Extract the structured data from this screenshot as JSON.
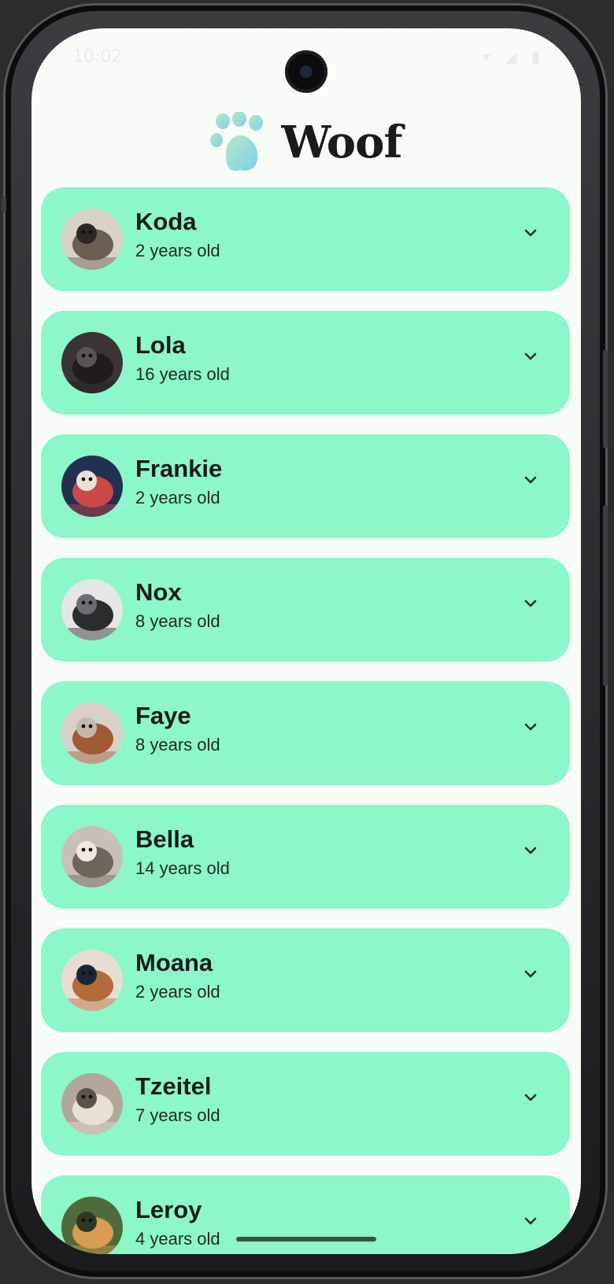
{
  "app": {
    "title": "Woof"
  },
  "status_bar": {
    "time": "10:02",
    "icons": "▾ ◢ ▮"
  },
  "dogs": [
    {
      "name": "Koda",
      "age": "2 years old",
      "photo": "husky-dog-photo",
      "palette": [
        "#d9d2c6",
        "#6b5e52",
        "#2d2826"
      ]
    },
    {
      "name": "Lola",
      "age": "16 years old",
      "photo": "black-dog-photo",
      "palette": [
        "#3a3532",
        "#1f1c1b",
        "#5a534e"
      ]
    },
    {
      "name": "Frankie",
      "age": "2 years old",
      "photo": "small-dog-photo",
      "palette": [
        "#223052",
        "#c94848",
        "#e9e2d8"
      ]
    },
    {
      "name": "Nox",
      "age": "8 years old",
      "photo": "dark-dog-photo",
      "palette": [
        "#e6e6e6",
        "#2c2c2e",
        "#6d6d72"
      ]
    },
    {
      "name": "Faye",
      "age": "8 years old",
      "photo": "puppy-on-carpet-photo",
      "palette": [
        "#d9d0c9",
        "#a15a32",
        "#c2b8ae"
      ]
    },
    {
      "name": "Bella",
      "age": "14 years old",
      "photo": "white-dog-photo",
      "palette": [
        "#c8c0b6",
        "#6e655c",
        "#efe9e2"
      ]
    },
    {
      "name": "Moana",
      "age": "2 years old",
      "photo": "corgi-blanket-photo",
      "palette": [
        "#e7ddd1",
        "#b56a3a",
        "#1b2634"
      ]
    },
    {
      "name": "Tzeitel",
      "age": "7 years old",
      "photo": "tan-dog-photo",
      "palette": [
        "#b3a79a",
        "#e9dfd2",
        "#5b534b"
      ]
    },
    {
      "name": "Leroy",
      "age": "4 years old",
      "photo": "corgi-grass-photo",
      "palette": [
        "#4f6b3a",
        "#d99c52",
        "#2c3a22"
      ]
    }
  ],
  "colors": {
    "screen_background": "#f8fcf6",
    "card_background": "#8cf7c8",
    "title_text": "#1a1c19",
    "logo_gradient_start": "#a7e3c0",
    "logo_gradient_end": "#7fd0ea"
  },
  "icons": {
    "expand": "chevron-down-icon",
    "logo": "paw-icon"
  }
}
